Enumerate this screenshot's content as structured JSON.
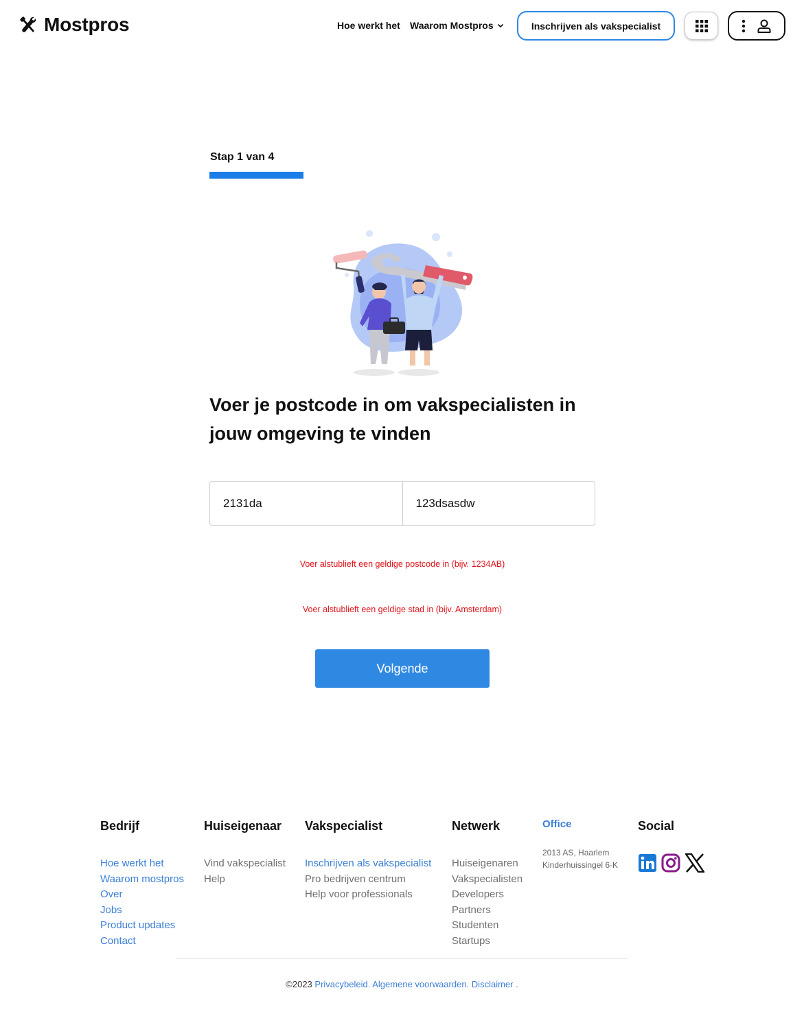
{
  "header": {
    "logo_text": "Mostpros",
    "nav": {
      "how_it_works": "Hoe werkt het",
      "why": "Waarom Mostpros"
    },
    "register_button": "Inschrijven als vakspecialist"
  },
  "stepper": {
    "label": "Stap 1 van 4",
    "progress": 0.25
  },
  "main": {
    "heading": "Voer je postcode in om vakspecialisten in jouw omgeving te vinden",
    "postcode_value": "2131da",
    "city_value": "123dsasdw",
    "error_postcode": "Voer alstublieft een geldige postcode in (bijv. 1234AB)",
    "error_city": "Voer alstublieft een geldige stad in (bijv. Amsterdam)",
    "next_button": "Volgende"
  },
  "footer": {
    "company": {
      "title": "Bedrijf",
      "links": [
        "Hoe werkt het",
        "Waarom mostpros",
        "Over",
        "Jobs",
        "Product updates",
        "Contact"
      ]
    },
    "homeowner": {
      "title": "Huiseigenaar",
      "links": [
        "Vind vakspecialist",
        "Help"
      ]
    },
    "specialist": {
      "title": "Vakspecialist",
      "links": [
        "Inschrijven als vakspecialist",
        "Pro bedrijven centrum",
        "Help voor professionals"
      ]
    },
    "network": {
      "title": "Netwerk",
      "links": [
        "Huiseigenaren",
        "Vakspecialisten",
        "Developers",
        "Partners",
        "Studenten",
        "Startups"
      ]
    },
    "office": {
      "title": "Office",
      "line1": "2013 AS, Haarlem",
      "line2": "Kinderhuissingel 6-K"
    },
    "social": {
      "title": "Social",
      "icons": [
        "linkedin-icon",
        "instagram-icon",
        "x-icon"
      ]
    },
    "copyright": "©2023",
    "privacy": "Privacybeleid.",
    "terms": "Algemene voorwaarden.",
    "disclaimer": "Disclaimer",
    "trailing": "."
  },
  "colors": {
    "accent": "#2f89e2",
    "progress": "#1a7de8",
    "error": "#e0131b",
    "link": "#3b7fd4"
  }
}
